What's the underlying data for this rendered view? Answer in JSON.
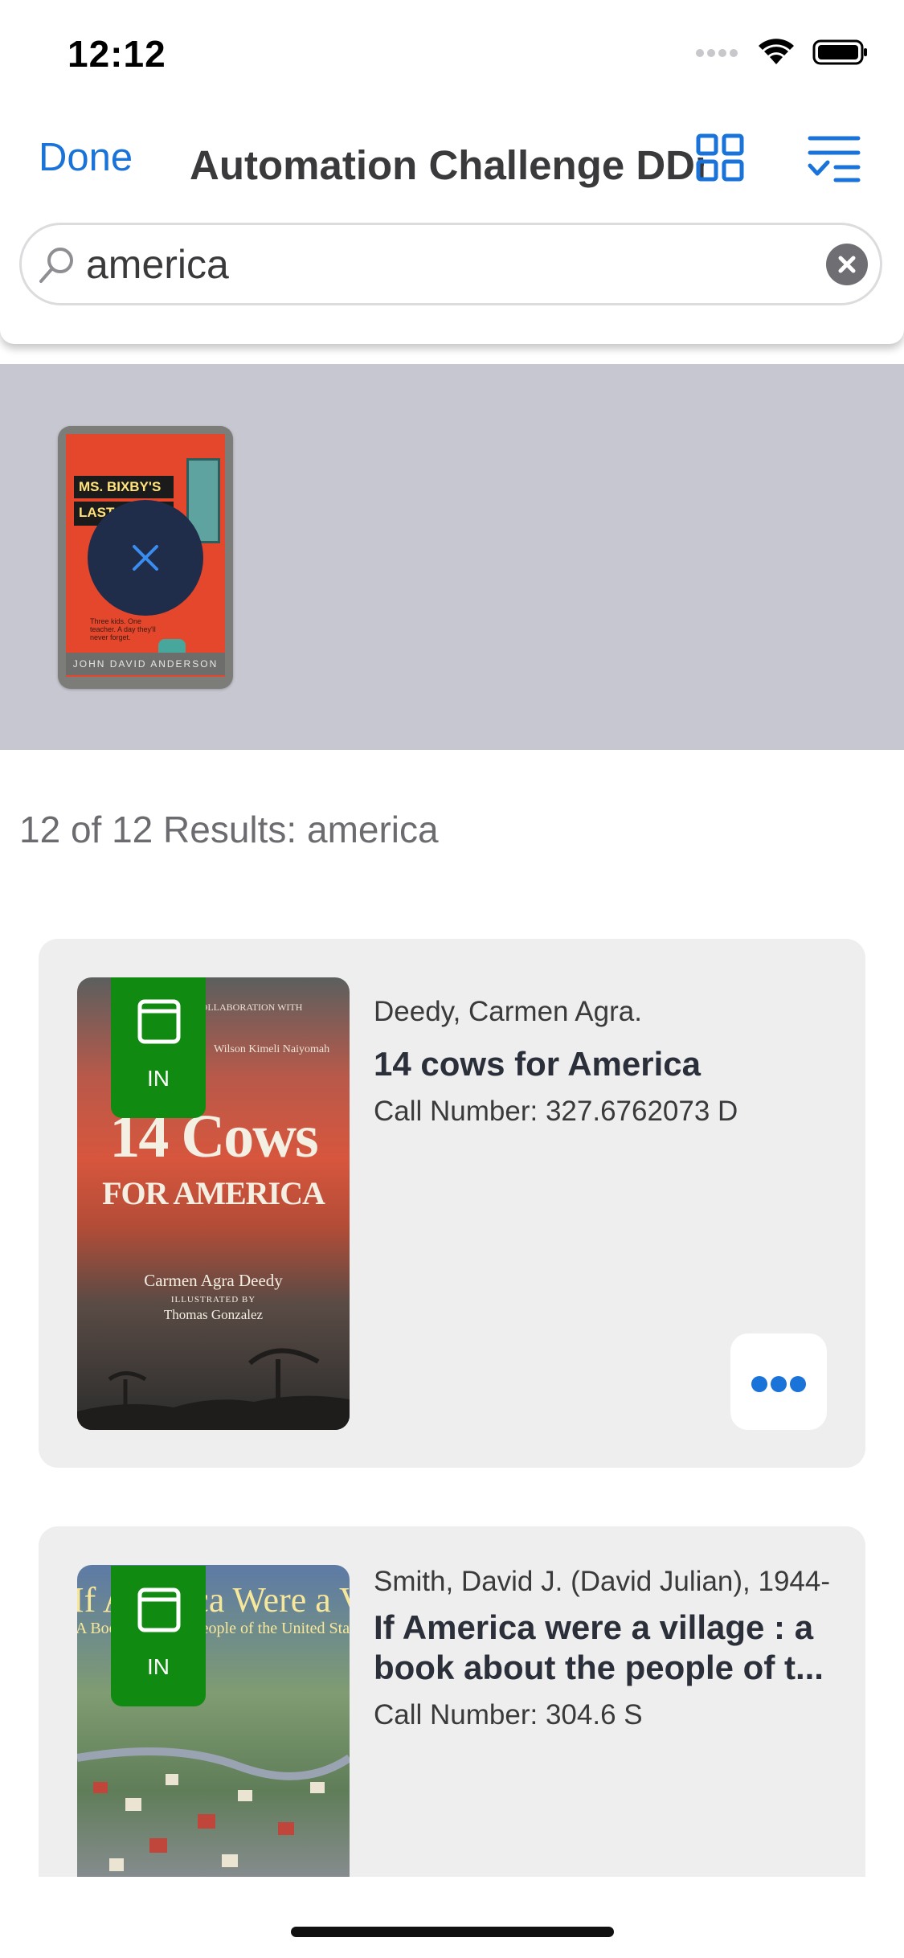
{
  "status_bar": {
    "time": "12:12"
  },
  "nav": {
    "done_label": "Done",
    "title": "Automation Challenge DDm",
    "grid_icon": "grid-icon",
    "filter_icon": "filter-list-icon"
  },
  "search": {
    "value": "america",
    "placeholder": ""
  },
  "selected_tray": {
    "book_cover_title_line1": "MS. BIXBY'S",
    "book_cover_title_line2": "LAST DAY",
    "book_cover_author": "JOHN DAVID ANDERSON",
    "book_cover_tagline": "Three kids. One teacher. A day they'll never forget."
  },
  "results": {
    "summary": "12 of 12 Results: america",
    "items": [
      {
        "status": "IN",
        "author": "Deedy, Carmen Agra.",
        "title": "14 cows for America",
        "call_number": "Call Number: 327.6762073 D",
        "cover": {
          "top_line": "IN COLLABORATION WITH",
          "top_name": "Wilson Kimeli Naiyomah",
          "title_line1": "14 Cows",
          "title_line2": "FOR AMERICA",
          "author": "Carmen Agra Deedy",
          "illustrated_by": "ILLUSTRATED BY",
          "illustrator": "Thomas Gonzalez"
        }
      },
      {
        "status": "IN",
        "author": "Smith, David J. (David Julian), 1944-",
        "title": "If America were a village : a book about the people of t...",
        "call_number": "Call Number: 304.6 S",
        "cover": {
          "title_line1": "If America Were a Village",
          "subtitle": "A Book about the People of the United States"
        }
      }
    ]
  },
  "colors": {
    "accent": "#1a73d9",
    "status_in": "#108a10",
    "tray": "#c7c7d1",
    "card": "#eeeeee"
  }
}
